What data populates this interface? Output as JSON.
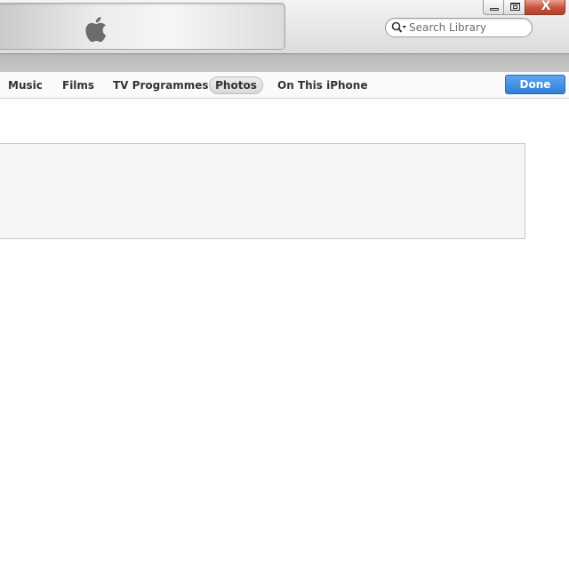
{
  "window": {
    "close_glyph": "X"
  },
  "search": {
    "placeholder": "Search Library",
    "value": ""
  },
  "nav": {
    "tabs": [
      {
        "label": "Music"
      },
      {
        "label": "Films"
      },
      {
        "label": "TV Programmes"
      },
      {
        "label": "Photos",
        "selected": true
      },
      {
        "label": "On This iPhone"
      }
    ],
    "done_label": "Done"
  },
  "colors": {
    "accent_button": "#3a8ee6",
    "close_button": "#c8513c"
  },
  "icons": {
    "logo": "apple-logo-icon",
    "search": "magnifier-icon",
    "minimize": "minimize-icon",
    "maximize": "maximize-icon",
    "close": "close-icon"
  }
}
